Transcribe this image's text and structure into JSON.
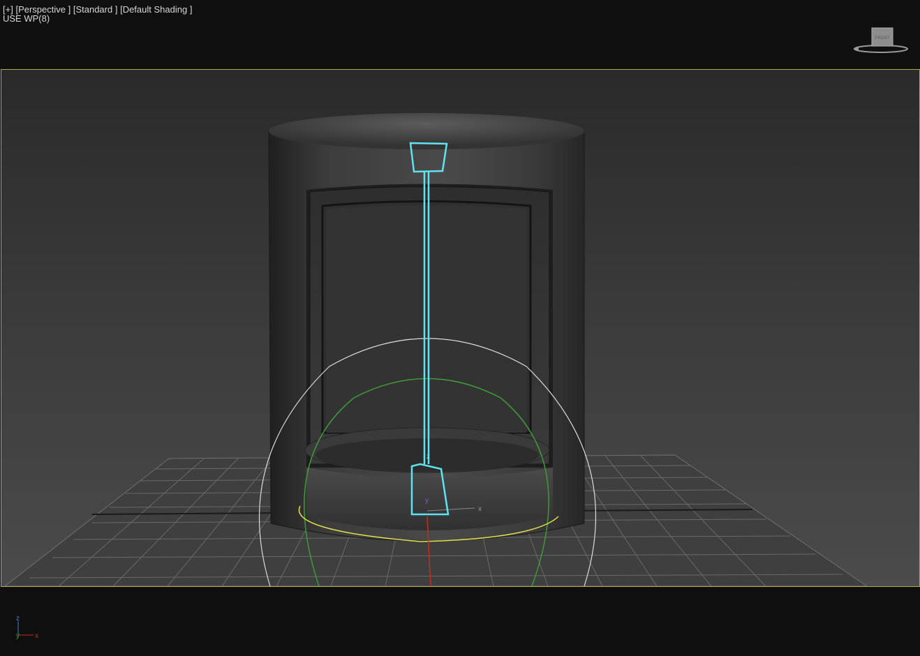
{
  "viewport": {
    "header": {
      "plus": "[+]",
      "view": "[Perspective ]",
      "mode": "[Standard ]",
      "shading": "[Default Shading ]"
    },
    "subtitle": "USE WP(8)"
  },
  "viewcube": {
    "face_label": "FRONT"
  },
  "gizmo": {
    "z_label": "z",
    "x_label": "x",
    "y_label": "y"
  },
  "axis_tripod": {
    "z": "z",
    "y": "y",
    "x": "x"
  },
  "colors": {
    "viewport_border": "#b3a94a",
    "selection": "#5fe3f0",
    "gizmo_white": "#dcdcdc",
    "gizmo_green": "#3f9a3a",
    "gizmo_yellow": "#e6e04a"
  }
}
